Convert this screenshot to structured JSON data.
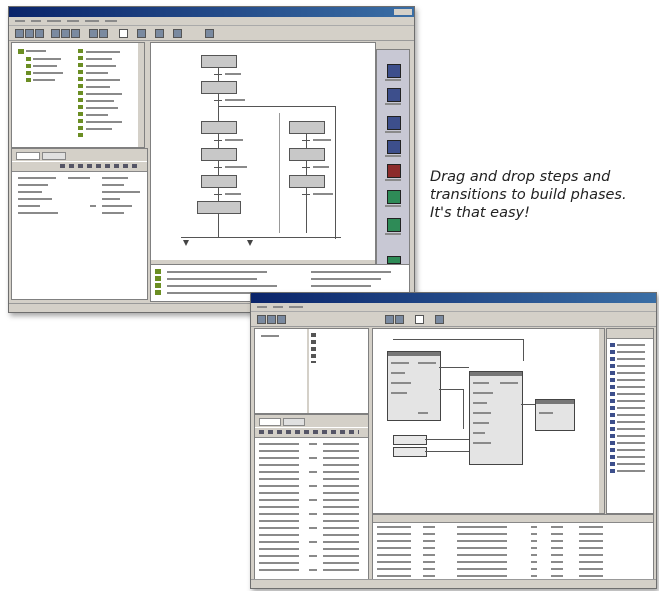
{
  "caption": {
    "line1": "Drag and drop steps and",
    "line2": "transitions to build phases.",
    "line3": "It's that easy!"
  },
  "colors": {
    "title_bar": "#0a246a",
    "window_chrome": "#d4d0c8",
    "toolbox_blue": "#3d4f8c",
    "toolbox_red": "#8c2b2b",
    "toolbox_green": "#2e8b57",
    "tree_green": "#6b8e23"
  },
  "windows": {
    "top": {
      "panes": [
        "tree-pane",
        "properties-pane",
        "sfc-canvas",
        "toolbox-palette",
        "message-list"
      ],
      "toolbox_icons": [
        "step-icon",
        "transition-icon",
        "branch-icon",
        "parallel-icon",
        "jump-icon",
        "end-icon",
        "green-step-icon",
        "green-transition-icon"
      ]
    },
    "bottom": {
      "panes": [
        "tree-pane",
        "parameter-list",
        "function-block-canvas",
        "block-palette",
        "tag-table"
      ]
    }
  }
}
